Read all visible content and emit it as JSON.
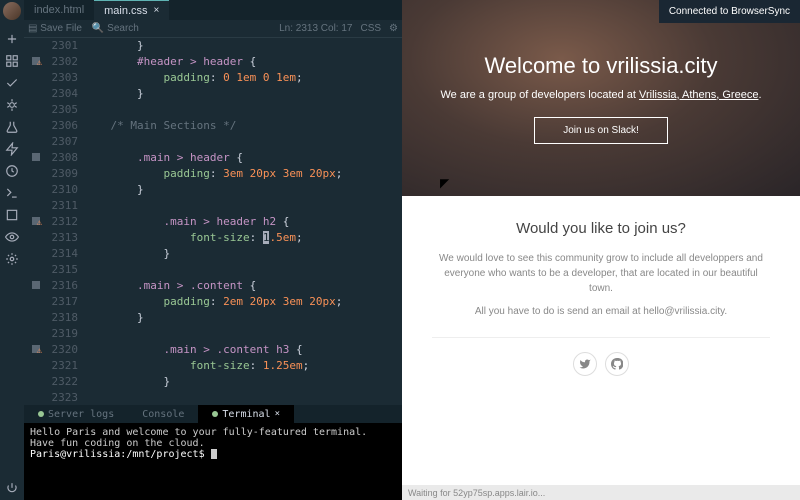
{
  "activity": {
    "icons": [
      "plus",
      "apps",
      "check",
      "bug",
      "beaker",
      "bolt",
      "clock",
      "terminal",
      "square",
      "eye",
      "gear"
    ],
    "bottom": "power"
  },
  "tabs": [
    {
      "label": "index.html",
      "active": false
    },
    {
      "label": "main.css",
      "active": true
    }
  ],
  "toolbar": {
    "save": "Save File",
    "search": "Search",
    "ln": "Ln: 2313 Col: 17",
    "lang": "CSS"
  },
  "code": {
    "first_line": 2301,
    "lines": [
      {
        "markers": [],
        "t": [
          [
            "        ",
            "b"
          ],
          [
            "}",
            "b"
          ]
        ]
      },
      {
        "markers": [
          "sq",
          "wr"
        ],
        "t": [
          [
            "        ",
            "b"
          ],
          [
            "#header > header ",
            "s"
          ],
          [
            "{",
            "b"
          ]
        ]
      },
      {
        "markers": [],
        "t": [
          [
            "            ",
            "b"
          ],
          [
            "padding",
            "p"
          ],
          [
            ": ",
            "b"
          ],
          [
            "0",
            "v"
          ],
          [
            " ",
            "b"
          ],
          [
            "1em",
            "v"
          ],
          [
            " ",
            "b"
          ],
          [
            "0",
            "v"
          ],
          [
            " ",
            "b"
          ],
          [
            "1em",
            "v"
          ],
          [
            ";",
            "b"
          ]
        ]
      },
      {
        "markers": [],
        "t": [
          [
            "        ",
            "b"
          ],
          [
            "}",
            "b"
          ]
        ]
      },
      {
        "markers": [],
        "t": [
          [
            "",
            "b"
          ]
        ]
      },
      {
        "markers": [],
        "t": [
          [
            "    ",
            "b"
          ],
          [
            "/* Main Sections */",
            "c"
          ]
        ]
      },
      {
        "markers": [],
        "t": [
          [
            "",
            "b"
          ]
        ]
      },
      {
        "markers": [
          "sq"
        ],
        "t": [
          [
            "        ",
            "b"
          ],
          [
            ".main > header ",
            "s"
          ],
          [
            "{",
            "b"
          ]
        ]
      },
      {
        "markers": [],
        "t": [
          [
            "            ",
            "b"
          ],
          [
            "padding",
            "p"
          ],
          [
            ": ",
            "b"
          ],
          [
            "3em",
            "v"
          ],
          [
            " ",
            "b"
          ],
          [
            "20px",
            "v"
          ],
          [
            " ",
            "b"
          ],
          [
            "3em",
            "v"
          ],
          [
            " ",
            "b"
          ],
          [
            "20px",
            "v"
          ],
          [
            ";",
            "b"
          ]
        ]
      },
      {
        "markers": [],
        "t": [
          [
            "        ",
            "b"
          ],
          [
            "}",
            "b"
          ]
        ]
      },
      {
        "markers": [],
        "t": [
          [
            "",
            "b"
          ]
        ]
      },
      {
        "markers": [
          "sq",
          "wr"
        ],
        "t": [
          [
            "            ",
            "b"
          ],
          [
            ".main > header h2 ",
            "s"
          ],
          [
            "{",
            "b"
          ]
        ]
      },
      {
        "markers": [],
        "t": [
          [
            "                ",
            "b"
          ],
          [
            "font-size",
            "p"
          ],
          [
            ": ",
            "b"
          ],
          [
            "1",
            "cur"
          ],
          [
            ".5em",
            "v"
          ],
          [
            ";",
            "b"
          ]
        ]
      },
      {
        "markers": [],
        "t": [
          [
            "            ",
            "b"
          ],
          [
            "}",
            "b"
          ]
        ]
      },
      {
        "markers": [],
        "t": [
          [
            "",
            "b"
          ]
        ]
      },
      {
        "markers": [
          "sq"
        ],
        "t": [
          [
            "        ",
            "b"
          ],
          [
            ".main > .content ",
            "s"
          ],
          [
            "{",
            "b"
          ]
        ]
      },
      {
        "markers": [],
        "t": [
          [
            "            ",
            "b"
          ],
          [
            "padding",
            "p"
          ],
          [
            ": ",
            "b"
          ],
          [
            "2em",
            "v"
          ],
          [
            " ",
            "b"
          ],
          [
            "20px",
            "v"
          ],
          [
            " ",
            "b"
          ],
          [
            "3em",
            "v"
          ],
          [
            " ",
            "b"
          ],
          [
            "20px",
            "v"
          ],
          [
            ";",
            "b"
          ]
        ]
      },
      {
        "markers": [],
        "t": [
          [
            "        ",
            "b"
          ],
          [
            "}",
            "b"
          ]
        ]
      },
      {
        "markers": [],
        "t": [
          [
            "",
            "b"
          ]
        ]
      },
      {
        "markers": [
          "sq",
          "wr"
        ],
        "t": [
          [
            "            ",
            "b"
          ],
          [
            ".main > .content h3 ",
            "s"
          ],
          [
            "{",
            "b"
          ]
        ]
      },
      {
        "markers": [],
        "t": [
          [
            "                ",
            "b"
          ],
          [
            "font-size",
            "p"
          ],
          [
            ": ",
            "b"
          ],
          [
            "1.25em",
            "v"
          ],
          [
            ";",
            "b"
          ]
        ]
      },
      {
        "markers": [],
        "t": [
          [
            "            ",
            "b"
          ],
          [
            "}",
            "b"
          ]
        ]
      },
      {
        "markers": [],
        "t": [
          [
            "",
            "b"
          ]
        ]
      },
      {
        "markers": [],
        "t": [
          [
            "    ",
            "b"
          ],
          [
            "}",
            "b"
          ]
        ]
      }
    ]
  },
  "panel": {
    "tabs": [
      {
        "label": "Server logs",
        "dot": true,
        "on": false
      },
      {
        "label": "Console",
        "dot": false,
        "on": false
      },
      {
        "label": "Terminal",
        "dot": true,
        "on": true,
        "close": true
      }
    ],
    "lines": [
      "Hello Paris and welcome to your fully-featured terminal.",
      "Have fun coding on the cloud."
    ],
    "prompt": "Paris@vrilissia:/mnt/project$ "
  },
  "preview": {
    "bsync": "Connected to BrowserSync",
    "hero_title": "Welcome to vrilissia.city",
    "hero_sub_pre": "We are a group of developers located at ",
    "hero_sub_loc": "Vrilissia, Athens, Greece",
    "hero_sub_post": ".",
    "hero_btn": "Join us on Slack!",
    "join_title": "Would you like to join us?",
    "join_p1": "We would love to see this community grow to include all developpers and everyone who wants to be a developer, that are located in our beautiful town.",
    "join_p2": "All you have to do is send an email at hello@vrilissia.city.",
    "status": "Waiting for 52yp75sp.apps.lair.io..."
  }
}
